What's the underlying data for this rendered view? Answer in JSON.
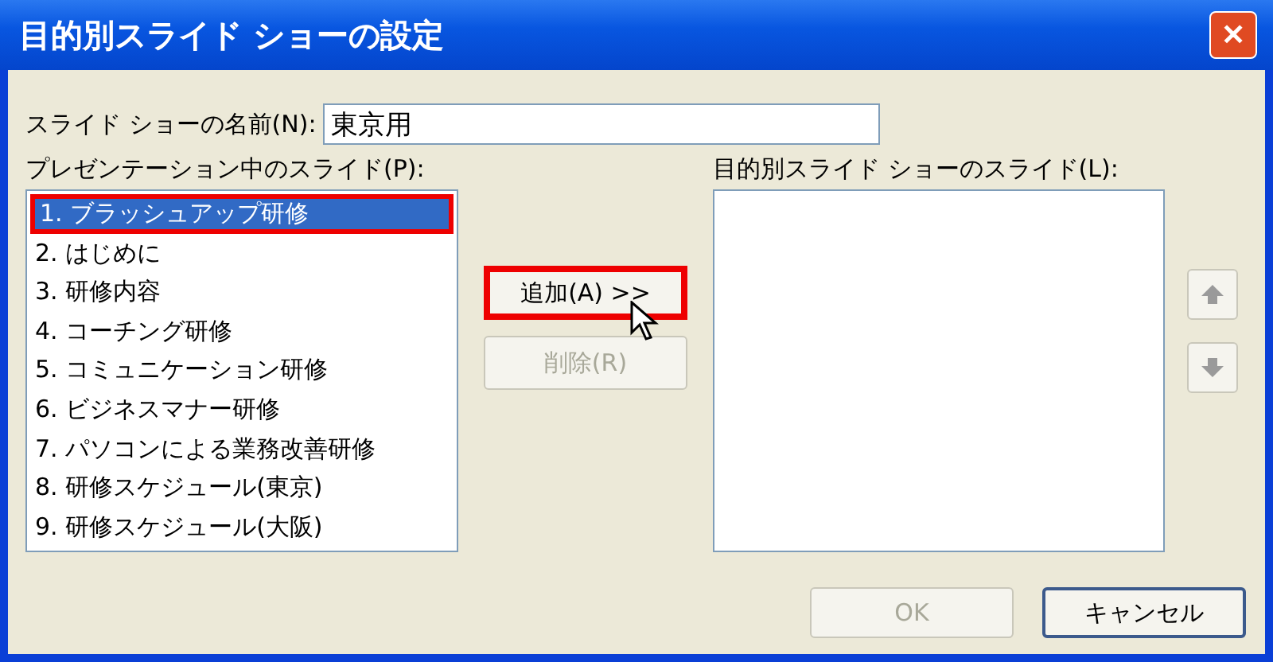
{
  "window": {
    "title": "目的別スライド ショーの設定",
    "close_label": "✕"
  },
  "name_field": {
    "label": "スライド ショーの名前(N):",
    "value": "東京用"
  },
  "presentation_slides": {
    "label": "プレゼンテーション中のスライド(P):",
    "items": [
      {
        "text": "1. ブラッシュアップ研修",
        "selected": true,
        "highlighted": true
      },
      {
        "text": "2. はじめに",
        "selected": false,
        "highlighted": false
      },
      {
        "text": "3. 研修内容",
        "selected": false,
        "highlighted": false
      },
      {
        "text": "4. コーチング研修",
        "selected": false,
        "highlighted": false
      },
      {
        "text": "5. コミュニケーション研修",
        "selected": false,
        "highlighted": false
      },
      {
        "text": "6. ビジネスマナー研修",
        "selected": false,
        "highlighted": false
      },
      {
        "text": "7. パソコンによる業務改善研修",
        "selected": false,
        "highlighted": false
      },
      {
        "text": "8. 研修スケジュール(東京)",
        "selected": false,
        "highlighted": false
      },
      {
        "text": "9. 研修スケジュール(大阪)",
        "selected": false,
        "highlighted": false
      }
    ]
  },
  "add_button": {
    "label": "追加(A) >>",
    "disabled": false,
    "highlighted": true
  },
  "remove_button": {
    "label": "削除(R)",
    "disabled": true,
    "highlighted": false
  },
  "custom_show_slides": {
    "label": "目的別スライド ショーのスライド(L):"
  },
  "move_buttons": [
    {
      "kind": "up"
    },
    {
      "kind": "down"
    }
  ],
  "buttons": [
    {
      "label": "OK",
      "disabled": true,
      "default": false
    },
    {
      "label": "キャンセル",
      "disabled": false,
      "default": true
    }
  ]
}
